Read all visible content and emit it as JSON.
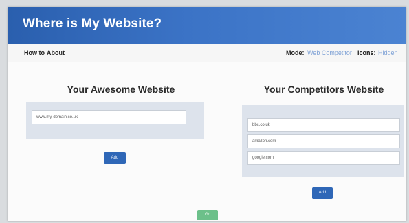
{
  "app": {
    "title": "Where is My Website?"
  },
  "nav": {
    "howto": "How to",
    "about": "About",
    "mode_label": "Mode:",
    "mode_value": "Web Competitor",
    "icons_label": "Icons:",
    "icons_value": "Hidden"
  },
  "left": {
    "title": "Your Awesome Website",
    "input_value": "www.my-domain.co.uk",
    "button_label": "Add"
  },
  "right": {
    "title": "Your Competitors Website",
    "inputs": [
      "bbc.co.uk",
      "amazon.com",
      "google.com"
    ],
    "button_label": "Add"
  },
  "go_button_label": "Go"
}
